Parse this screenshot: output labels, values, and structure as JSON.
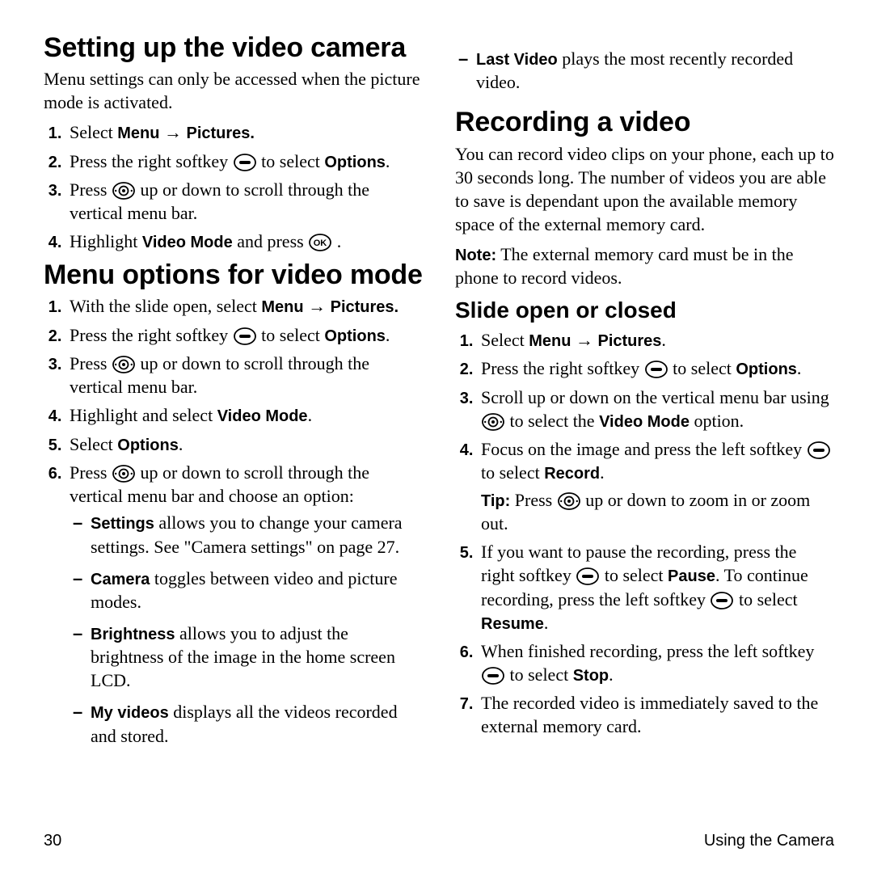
{
  "left": {
    "h1": "Setting up the video camera",
    "intro": "Menu settings can only be accessed when the picture mode is activated.",
    "steps1": {
      "s1_a": "Select ",
      "s1_b": "Menu",
      "s1_c": " → ",
      "s1_d": "Pictures.",
      "s2_a": "Press the right softkey ",
      "s2_b": " to select ",
      "s2_c": "Options",
      "s2_d": ".",
      "s3_a": "Press ",
      "s3_b": " up or down to scroll through the vertical menu bar.",
      "s4_a": "Highlight ",
      "s4_b": "Video Mode",
      "s4_c": " and press ",
      "s4_d": " ."
    },
    "h2": "Menu options for video mode",
    "steps2": {
      "s1_a": "With the slide open, select ",
      "s1_b": "Menu",
      "s1_c": " → ",
      "s1_d": "Pictures.",
      "s2_a": "Press the right softkey ",
      "s2_b": " to select ",
      "s2_c": "Options",
      "s2_d": ".",
      "s3_a": "Press ",
      "s3_b": " up or down to scroll through the vertical menu bar.",
      "s4_a": "Highlight and select ",
      "s4_b": "Video Mode",
      "s4_c": ".",
      "s5_a": "Select ",
      "s5_b": "Options",
      "s5_c": ".",
      "s6_a": "Press ",
      "s6_b": " up or down to scroll through the vertical menu bar and choose an option:"
    },
    "opts": {
      "o1_a": "Settings",
      "o1_b": " allows you to change your camera settings. See \"Camera settings\" on page 27.",
      "o2_a": "Camera",
      "o2_b": " toggles between video and picture modes.",
      "o3_a": "Brightness",
      "o3_b": " allows you to adjust the brightness of the image in the home screen LCD.",
      "o4_a": "My videos",
      "o4_b": " displays all the videos recorded and stored."
    }
  },
  "right": {
    "carry": {
      "a": "Last Video",
      "b": " plays the most recently recorded video."
    },
    "h1": "Recording a video",
    "intro": "You can record video clips on your phone, each up to 30 seconds long. The number of videos you are able to save is dependant upon the available memory space of the external memory card.",
    "note_label": "Note:",
    "note_text": "  The external memory card must be in the phone to record videos.",
    "h2": "Slide open or closed",
    "steps": {
      "s1_a": "Select ",
      "s1_b": "Menu",
      "s1_c": " → ",
      "s1_d": "Pictures",
      "s1_e": ".",
      "s2_a": "Press the right softkey ",
      "s2_b": " to select ",
      "s2_c": "Options",
      "s2_d": ".",
      "s3_a": "Scroll up or down on the vertical menu bar using ",
      "s3_b": " to select the ",
      "s3_c": "Video Mode",
      "s3_d": " option.",
      "s4_a": "Focus on the image and press the left softkey ",
      "s4_b": " to select ",
      "s4_c": "Record",
      "s4_d": ".",
      "tip_label": "Tip:",
      "tip_a": "  Press ",
      "tip_b": " up or down to zoom in or zoom out.",
      "s5_a": "If you want to pause the recording, press the right softkey ",
      "s5_b": " to select ",
      "s5_c": "Pause",
      "s5_d": ". To continue recording, press the left softkey ",
      "s5_e": " to select ",
      "s5_f": "Resume",
      "s5_g": ".",
      "s6_a": "When finished recording, press the left softkey ",
      "s6_b": " to select ",
      "s6_c": "Stop",
      "s6_d": ".",
      "s7": "The recorded video is immediately saved to the external memory card."
    }
  },
  "footer": {
    "page": "30",
    "section": "Using the Camera"
  }
}
